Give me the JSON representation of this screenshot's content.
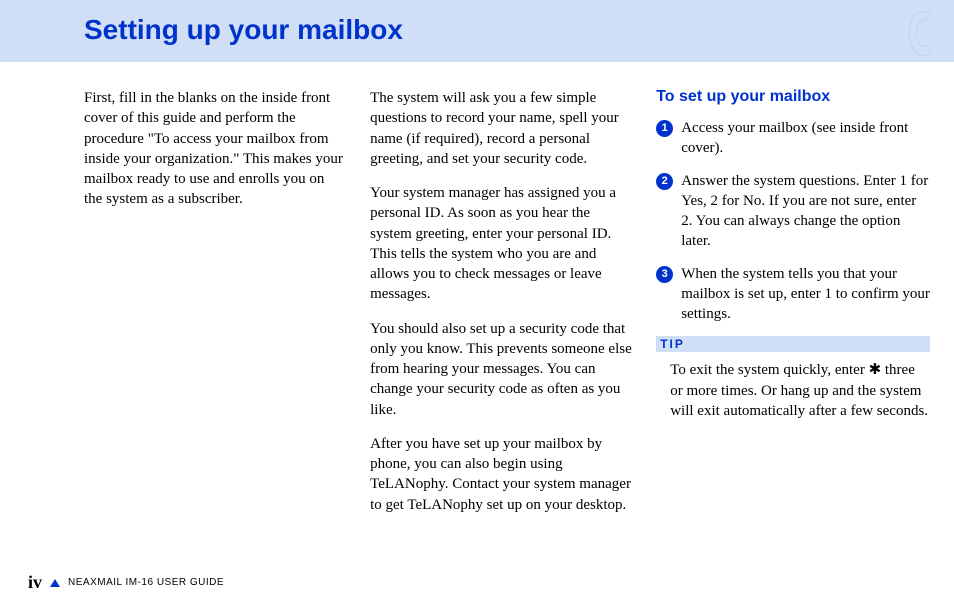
{
  "header": {
    "title": "Setting up your mailbox"
  },
  "col1": {
    "p1": "First, fill in the blanks on the inside front cover of this guide and perform the procedure \"To access your mailbox from inside your organization.\" This makes your mailbox ready to use and enrolls you on the system as a subscriber."
  },
  "col2": {
    "p1": "The system will ask you a few simple questions to record your name, spell your name (if required), record a personal greeting, and set your security code.",
    "p2": "Your system manager has assigned you a personal ID. As soon as you hear the system greeting, enter your personal ID. This tells the system who you are and allows you to check messages or leave messages.",
    "p3": "You should also set up a security code that only you know. This prevents someone else from hearing your messages. You can change your security code as often as you like.",
    "p4": "After you have set up your mailbox by phone, you can also begin using TeLANophy. Contact your system manager to get TeLANophy set up on your desktop."
  },
  "col3": {
    "heading": "To set up your mailbox",
    "steps": [
      {
        "n": "1",
        "text": "Access your mailbox (see inside front cover)."
      },
      {
        "n": "2",
        "text": "Answer the system questions. Enter 1 for Yes, 2 for No. If you are not sure, enter 2. You can always change the option later."
      },
      {
        "n": "3",
        "text": "When the system tells you that your mailbox is set up, enter 1 to confirm your settings."
      }
    ],
    "tip_label": "TIP",
    "tip_body": "To exit the system quickly, enter ✱ three or more times. Or hang up and the system will exit automatically after a few seconds."
  },
  "footer": {
    "page": "iv",
    "guide": "NEAXMAIL IM-16 USER GUIDE"
  }
}
